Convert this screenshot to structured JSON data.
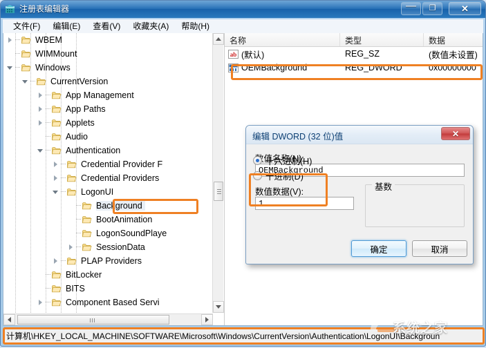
{
  "window": {
    "title": "注册表编辑器",
    "icon": "registry-editor-icon",
    "minimize_label": "—",
    "maximize_label": "❐",
    "close_label": "✕"
  },
  "menu": {
    "items": [
      {
        "label": "文件(F)"
      },
      {
        "label": "编辑(E)"
      },
      {
        "label": "查看(V)"
      },
      {
        "label": "收藏夹(A)"
      },
      {
        "label": "帮助(H)"
      }
    ]
  },
  "tree": {
    "rows": [
      {
        "label": "WBEM",
        "indent": 3,
        "toggle": "collapsed",
        "selected": false
      },
      {
        "label": "WIMMount",
        "indent": 3,
        "toggle": "leaf",
        "selected": false
      },
      {
        "label": "Windows",
        "indent": 3,
        "toggle": "expanded",
        "selected": false
      },
      {
        "label": "CurrentVersion",
        "indent": 4,
        "toggle": "expanded",
        "selected": false
      },
      {
        "label": "App Management",
        "indent": 5,
        "toggle": "collapsed",
        "selected": false
      },
      {
        "label": "App Paths",
        "indent": 5,
        "toggle": "collapsed",
        "selected": false
      },
      {
        "label": "Applets",
        "indent": 5,
        "toggle": "collapsed",
        "selected": false
      },
      {
        "label": "Audio",
        "indent": 5,
        "toggle": "leaf",
        "selected": false
      },
      {
        "label": "Authentication",
        "indent": 5,
        "toggle": "expanded",
        "selected": false
      },
      {
        "label": "Credential Provider F",
        "indent": 6,
        "toggle": "collapsed",
        "selected": false
      },
      {
        "label": "Credential Providers",
        "indent": 6,
        "toggle": "collapsed",
        "selected": false
      },
      {
        "label": "LogonUI",
        "indent": 6,
        "toggle": "expanded",
        "selected": false
      },
      {
        "label": "Background",
        "indent": 7,
        "toggle": "leaf",
        "selected": true
      },
      {
        "label": "BootAnimation",
        "indent": 7,
        "toggle": "leaf",
        "selected": false
      },
      {
        "label": "LogonSoundPlaye",
        "indent": 7,
        "toggle": "leaf",
        "selected": false
      },
      {
        "label": "SessionData",
        "indent": 7,
        "toggle": "collapsed",
        "selected": false
      },
      {
        "label": "PLAP Providers",
        "indent": 6,
        "toggle": "collapsed",
        "selected": false
      },
      {
        "label": "BitLocker",
        "indent": 5,
        "toggle": "leaf",
        "selected": false
      },
      {
        "label": "BITS",
        "indent": 5,
        "toggle": "leaf",
        "selected": false
      },
      {
        "label": "Component Based Servi",
        "indent": 5,
        "toggle": "collapsed",
        "selected": false
      }
    ]
  },
  "list": {
    "headers": {
      "name": "名称",
      "type": "类型",
      "data": "数据"
    },
    "rows": [
      {
        "name": "(默认)",
        "type": "REG_SZ",
        "data": "(数值未设置)",
        "icon": "string-value-icon"
      },
      {
        "name": "OEMBackground",
        "type": "REG_DWORD",
        "data": "0x00000000",
        "icon": "binary-value-icon"
      }
    ]
  },
  "statusbar": {
    "path": "计算机\\HKEY_LOCAL_MACHINE\\SOFTWARE\\Microsoft\\Windows\\CurrentVersion\\Authentication\\LogonUI\\Backgroun"
  },
  "dialog": {
    "title": "编辑 DWORD (32 位)值",
    "close_label": "✕",
    "value_name_label": "数值名称(N):",
    "value_name": "OEMBackground",
    "value_data_label": "数值数据(V):",
    "value_data": "1",
    "radix_label": "基数",
    "radix_options": [
      {
        "label": "十六进制(H)",
        "selected": true
      },
      {
        "label": "十进制(D)",
        "selected": false
      }
    ],
    "ok_label": "确定",
    "cancel_label": "取消"
  },
  "watermark": {
    "text": "系统之家"
  },
  "colors": {
    "annotation": "#ef8023",
    "titlebar": "#1d6ab4",
    "selection": "#e8eef5"
  }
}
